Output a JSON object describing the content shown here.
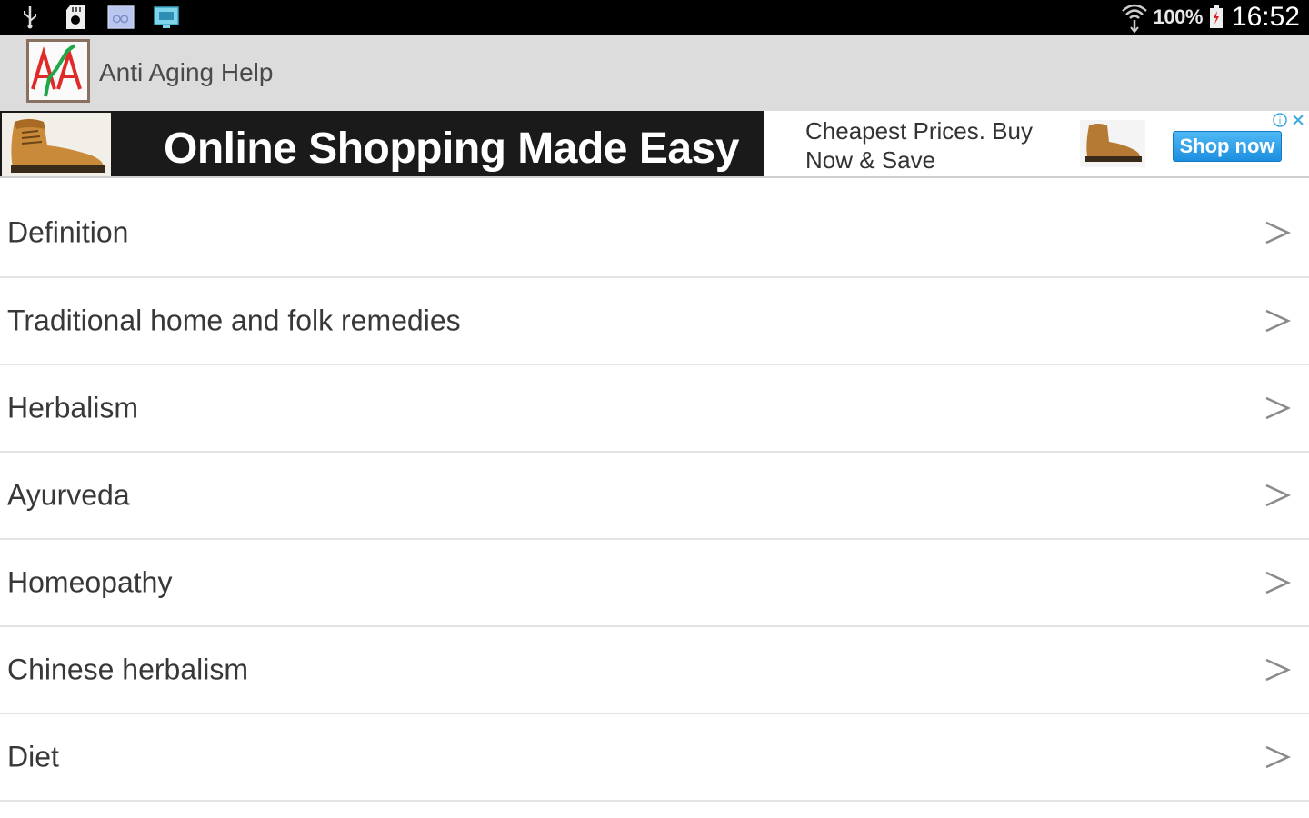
{
  "status_bar": {
    "left_icons": [
      "usb-icon",
      "sd-card-icon",
      "photo-notification-icon",
      "screen-notification-icon"
    ],
    "right_icons": [
      "wifi-icon",
      "battery-icon"
    ],
    "battery_percent": "100%",
    "time": "16:52"
  },
  "app_bar": {
    "logo_icon": "app-logo-icon",
    "title": "Anti Aging Help"
  },
  "ad": {
    "headline": "Online Shopping Made Easy",
    "subtext_line1": "Cheapest Prices. Buy",
    "subtext_line2": "Now & Save",
    "cta_label": "Shop now",
    "images": [
      "shoe-image",
      "shoe-thumbnail"
    ],
    "choice_icons": [
      "adchoices-icon",
      "close-icon"
    ],
    "cta_color": "#1d8fe0"
  },
  "menu": {
    "chevron_glyph": ">",
    "items": [
      {
        "label": "Definition"
      },
      {
        "label": "Traditional home and folk remedies"
      },
      {
        "label": "Herbalism"
      },
      {
        "label": "Ayurveda"
      },
      {
        "label": "Homeopathy"
      },
      {
        "label": "Chinese herbalism"
      },
      {
        "label": "Diet"
      }
    ]
  }
}
